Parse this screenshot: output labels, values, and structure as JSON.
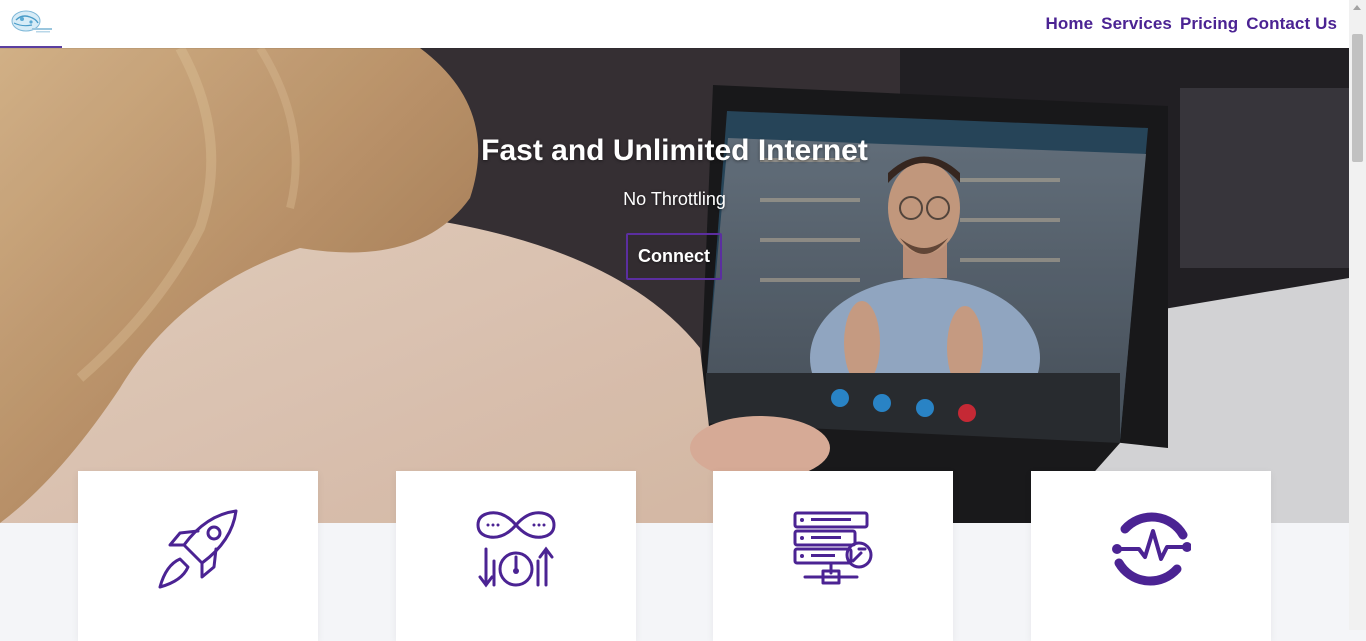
{
  "header": {
    "logo_name": "globe-logo",
    "nav": [
      {
        "label": "Home"
      },
      {
        "label": "Services"
      },
      {
        "label": "Pricing"
      },
      {
        "label": "Contact Us"
      }
    ]
  },
  "hero": {
    "title": "Fast and Unlimited Internet",
    "subtitle": "No Throttling",
    "cta_label": "Connect"
  },
  "features": [
    {
      "icon": "rocket-icon"
    },
    {
      "icon": "infinity-speedometer-icon"
    },
    {
      "icon": "server-settings-icon"
    },
    {
      "icon": "pulse-icon"
    }
  ],
  "colors": {
    "accent": "#4b2393",
    "header_bg": "#ffffff",
    "section_bg": "#f4f5f8",
    "card_bg": "#ffffff"
  }
}
